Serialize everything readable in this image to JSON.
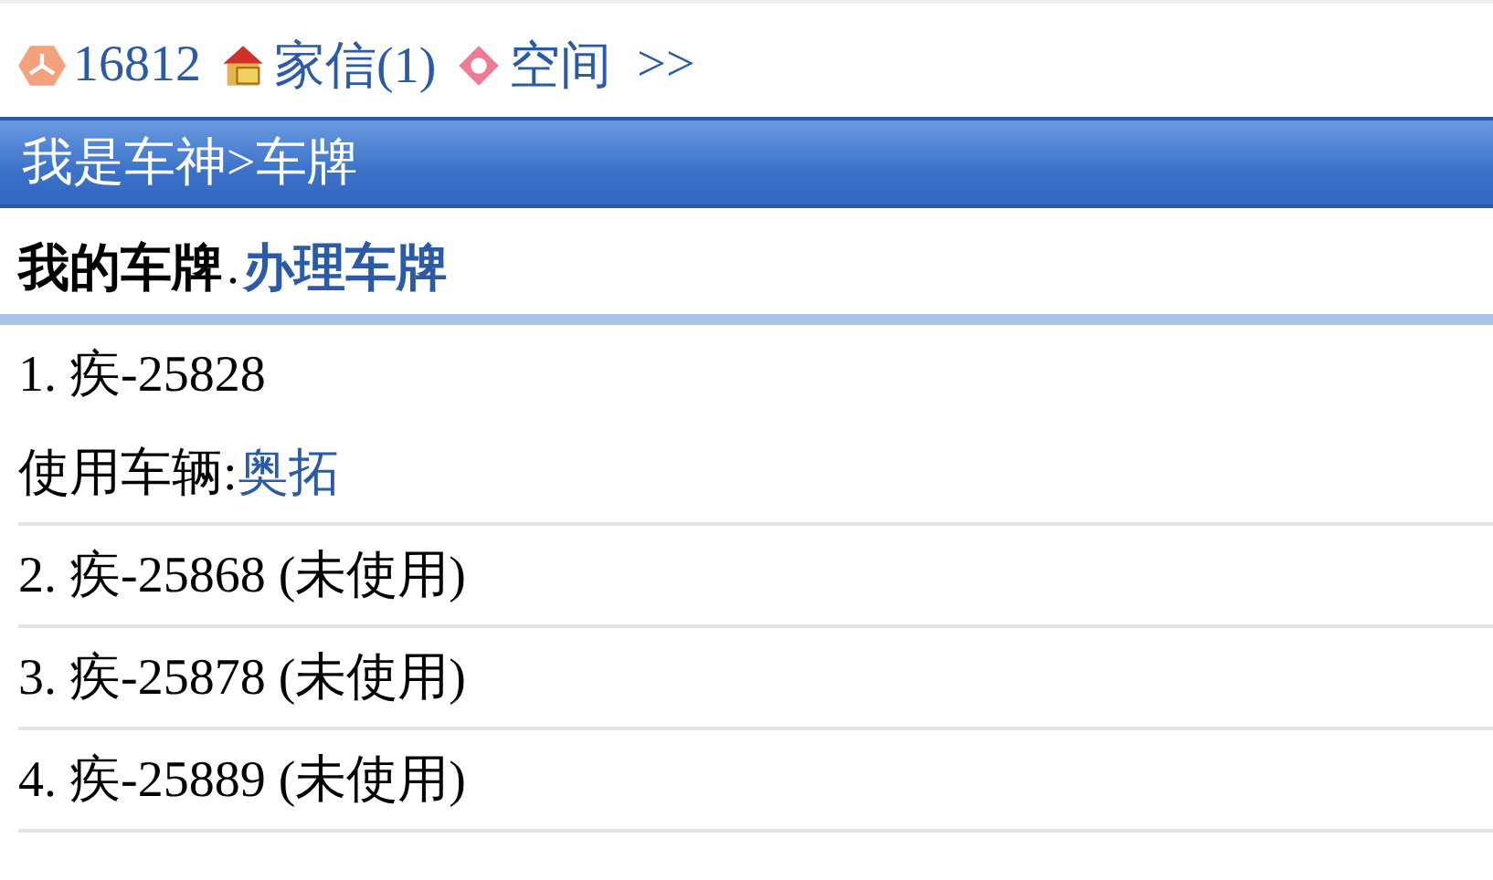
{
  "top_bar": {
    "score": "16812",
    "mail": "家信(1)",
    "space": "空间",
    "more": ">>"
  },
  "header": {
    "title": "我是车神>车牌"
  },
  "section": {
    "title": "我的车牌",
    "separator": ".",
    "link": "办理车牌"
  },
  "plates": [
    {
      "text": "1. 疾-25828",
      "vehicle_label": "使用车辆:",
      "vehicle": "奥拓"
    },
    {
      "text": "2. 疾-25868 (未使用)"
    },
    {
      "text": "3. 疾-25878 (未使用)"
    },
    {
      "text": "4. 疾-25889 (未使用)"
    }
  ]
}
